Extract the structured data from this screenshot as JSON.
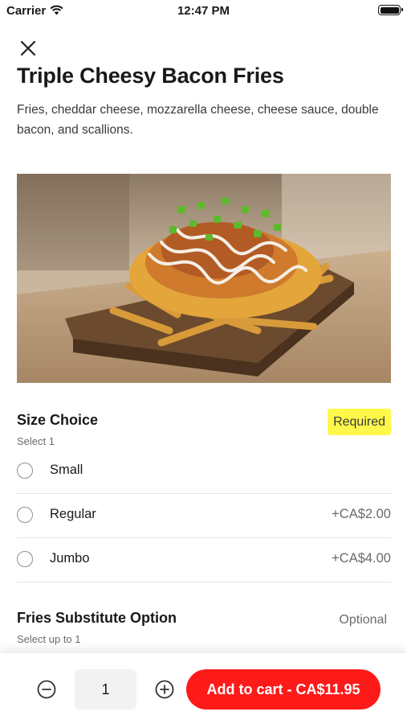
{
  "status_bar": {
    "carrier": "Carrier",
    "time": "12:47 PM"
  },
  "item": {
    "title": "Triple Cheesy Bacon Fries",
    "description": "Fries, cheddar cheese, mozzarella cheese, cheese sauce, double bacon, and scallions."
  },
  "size_section": {
    "title": "Size Choice",
    "subtitle": "Select 1",
    "badge": "Required",
    "options": [
      {
        "label": "Small",
        "price": ""
      },
      {
        "label": "Regular",
        "price": "+CA$2.00"
      },
      {
        "label": "Jumbo",
        "price": "+CA$4.00"
      }
    ]
  },
  "substitute_section": {
    "title": "Fries Substitute Option",
    "subtitle": "Select up to 1",
    "badge": "Optional"
  },
  "bottom_bar": {
    "quantity": "1",
    "add_to_cart_label": "Add to cart - CA$11.95"
  },
  "colors": {
    "accent": "#ff1a1a",
    "required_badge": "#fff84a"
  },
  "icons": [
    "wifi-icon",
    "battery-icon",
    "close-icon",
    "minus-circle-icon",
    "plus-circle-icon",
    "radio-icon"
  ]
}
